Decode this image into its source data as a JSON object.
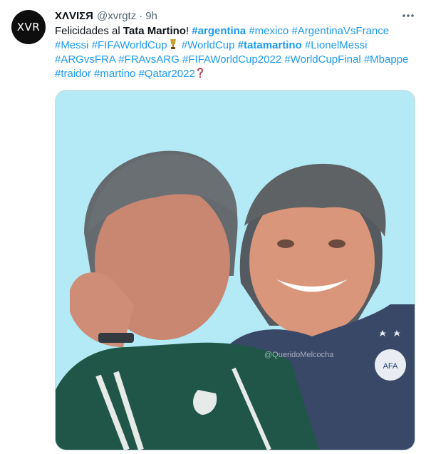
{
  "colors": {
    "link": "#1d9bf0",
    "text": "#0f1419",
    "secondary": "#536471",
    "media_background": "#b3eaf6"
  },
  "author": {
    "avatar_text": "XVR",
    "name": "ΧΛVIΣЯ",
    "handle": "@xvrgtz",
    "separator": "·",
    "time": "9h"
  },
  "tweet": {
    "greeting": "Felicidades al ",
    "mention": "Tata Martino",
    "exclamation": "! ",
    "tags": {
      "argentina": "#argentina",
      "mexico": "#mexico",
      "argvsfrance": "#ArgentinaVsFrance",
      "messi": "#Messi",
      "fifaworldcup": "#FIFAWorldCup",
      "worldcup": "#WorldCup",
      "tatamartino": "#tatamartino",
      "lionelmessi": "#LionelMessi",
      "argvsfra": "#ARGvsFRA",
      "fravsarg": "#FRAvsARG",
      "fifaworldcup2022": "#FIFAWorldCup2022",
      "worldcupfinal": "#WorldCupFinal",
      "mbappe": "#Mbappe",
      "traidor": "#traidor",
      "martino": "#martino",
      "qatar2022": "#Qatar2022"
    },
    "emoji_icons": [
      "trophy-icon",
      "question-mark-icon"
    ]
  },
  "media": {
    "watermark": "@QueridoMelcocha",
    "icon": "photo-icon"
  },
  "icons": {
    "more": "more-options-icon"
  }
}
